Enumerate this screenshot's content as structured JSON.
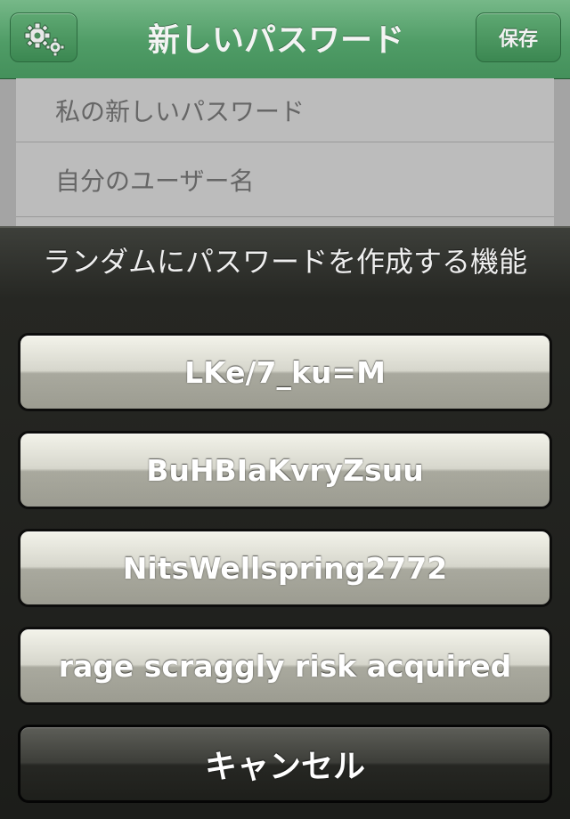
{
  "nav": {
    "settings_icon": "gear-icon",
    "title": "新しいパスワード",
    "save_label": "保存",
    "bar_color": "#4f9c66"
  },
  "form": {
    "rows": [
      {
        "placeholder": "私の新しいパスワード"
      },
      {
        "placeholder": "自分のユーザー名"
      }
    ]
  },
  "sheet": {
    "title": "ランダムにパスワードを作成する機能",
    "options": [
      "LKe/7_ku=M",
      "BuHBIaKvryZsuu",
      "NitsWellspring2772",
      "rage scraggly risk acquired"
    ],
    "cancel_label": "キャンセル"
  }
}
